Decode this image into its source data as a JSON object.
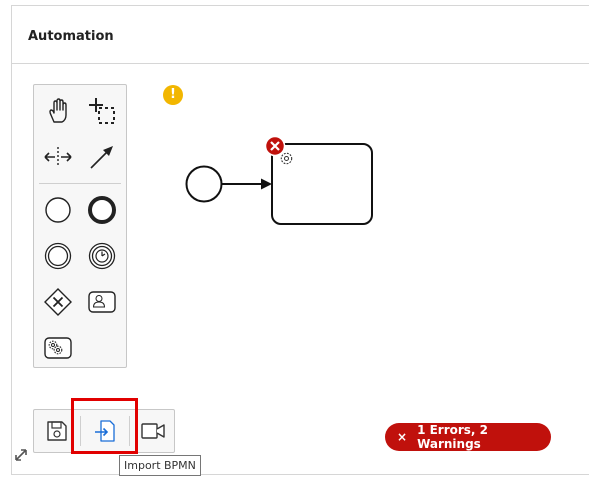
{
  "panel": {
    "title": "Automation"
  },
  "palette": {
    "tools": [
      {
        "name": "hand-tool",
        "icon": "hand-icon"
      },
      {
        "name": "lasso-tool",
        "icon": "lasso-icon"
      },
      {
        "name": "space-tool",
        "icon": "space-icon"
      },
      {
        "name": "connect-tool",
        "icon": "arrow-icon"
      },
      {
        "name": "start-event",
        "icon": "circle-icon"
      },
      {
        "name": "end-event",
        "icon": "thick-circle-icon"
      },
      {
        "name": "intermediate-event",
        "icon": "double-circle-icon"
      },
      {
        "name": "timer-event",
        "icon": "timer-icon"
      },
      {
        "name": "exclusive-gateway",
        "icon": "gateway-icon"
      },
      {
        "name": "user-task",
        "icon": "user-task-icon"
      },
      {
        "name": "service-task",
        "icon": "service-task-icon"
      }
    ]
  },
  "toolbar": {
    "buttons": [
      {
        "name": "save",
        "icon": "save-icon"
      },
      {
        "name": "import-bpmn",
        "icon": "import-icon"
      },
      {
        "name": "record",
        "icon": "video-icon"
      }
    ],
    "tooltip": "Import BPMN"
  },
  "status": {
    "badge": "1 Errors, 2 Warnings",
    "warning_glyph": "!",
    "error_glyph": "×",
    "colors": {
      "error": "#c0110c",
      "warning": "#f2b600",
      "highlight": "#e10000",
      "accent": "#1a6ed8"
    }
  }
}
